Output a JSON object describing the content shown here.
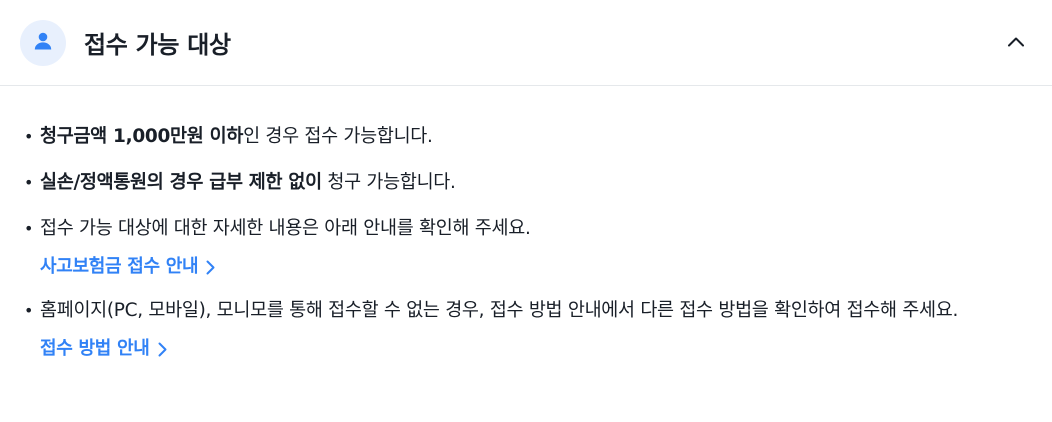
{
  "header": {
    "title": "접수 가능 대상",
    "avatar_icon": "user-icon",
    "collapse_icon": "chevron-up-icon"
  },
  "items": [
    {
      "bold": "청구금액 1,000만원 이하",
      "text": "인 경우 접수 가능합니다."
    },
    {
      "bold": "실손/정액통원의 경우 급부 제한 없이",
      "text": " 청구 가능합니다."
    },
    {
      "bold": "",
      "text": "접수 가능 대상에 대한 자세한 내용은 아래 안내를 확인해 주세요."
    },
    {
      "bold": "",
      "text": "홈페이지(PC, 모바일), 모니모를 통해 접수할 수 없는 경우, 접수 방법 안내에서 다른 접수 방법을 확인하여 접수해 주세요."
    }
  ],
  "links": {
    "accident_insurance": "사고보험금 접수 안내",
    "claim_method": "접수 방법 안내"
  },
  "colors": {
    "accent": "#3182f6",
    "avatar_bg": "#e8f0fd",
    "text": "#191f28",
    "divider": "#e5e8eb"
  }
}
